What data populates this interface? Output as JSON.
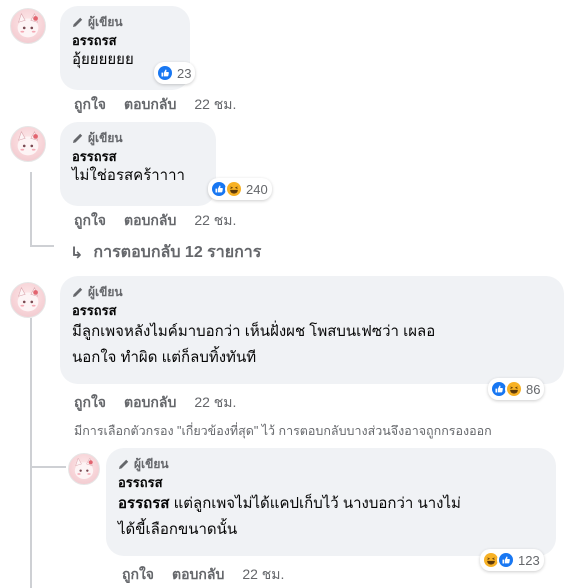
{
  "comments": [
    {
      "badge": "ผู้เขียน",
      "author": "อรรถรส",
      "text": "อุ้ยยยยยย",
      "reaction_count": "23",
      "reactions": [
        "like-icon"
      ],
      "like_label": "ถูกใจ",
      "reply_label": "ตอบกลับ",
      "time": "22 ชม."
    },
    {
      "badge": "ผู้เขียน",
      "author": "อรรถรส",
      "text": "ไม่ใช่อรสคร้าาาา",
      "reaction_count": "240",
      "reactions": [
        "like-icon",
        "haha-icon"
      ],
      "like_label": "ถูกใจ",
      "reply_label": "ตอบกลับ",
      "time": "22 ชม."
    },
    {
      "badge": "ผู้เขียน",
      "author": "อรรถรส",
      "text_line1": "มีลูกเพจหลังไมค์มาบอกว่า เห็นฝั่งผช โพสบนเฟซว่า เผลอ",
      "text_line2": "นอกใจ ทำผิด แต่ก็ลบทิ้งทันที",
      "reaction_count": "86",
      "reactions": [
        "like-icon",
        "haha-icon"
      ],
      "like_label": "ถูกใจ",
      "reply_label": "ตอบกลับ",
      "time": "22 ชม."
    },
    {
      "badge": "ผู้เขียน",
      "author": "อรรถรส",
      "mention": "อรรถรส",
      "text_line1": " แต่ลูกเพจไม่ได้แคปเก็บไว้ นางบอกว่า นางไม่",
      "text_line2": "ได้ขี้เลือกขนาดนั้น",
      "reaction_count": "123",
      "reactions": [
        "haha-icon",
        "like-icon"
      ],
      "like_label": "ถูกใจ",
      "reply_label": "ตอบกลับ",
      "time": "22 ชม."
    }
  ],
  "view_replies": {
    "arrow": "↳",
    "label": "การตอบกลับ 12 รายการ"
  },
  "filter_note": "มีการเลือกตัวกรอง \"เกี่ยวข้องที่สุด\" ไว้ การตอบกลับบางส่วนจึงอาจถูกกรองออก",
  "colors": {
    "bubble": "#f0f2f5",
    "secondary_text": "#65676b",
    "like_blue": "#1877f2",
    "haha_yellow": "#f7b125"
  }
}
